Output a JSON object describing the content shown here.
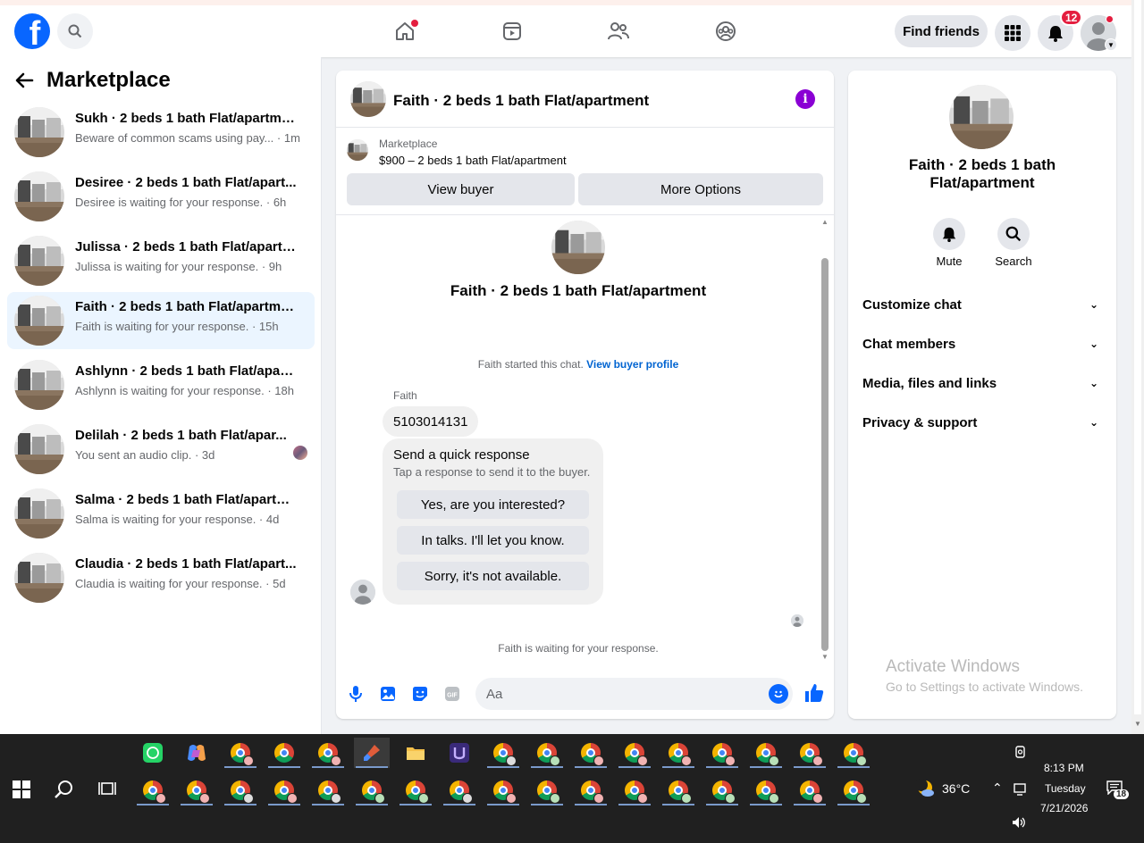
{
  "topbar": {
    "logo_letter": "f",
    "find_friends_label": "Find friends",
    "notifications_count": "12"
  },
  "sidebar": {
    "title": "Marketplace",
    "conversations": [
      {
        "title": "Sukh · 2 beds 1 bath Flat/apartment",
        "subtitle": "Beware of common scams using pay... · 1m"
      },
      {
        "title": "Desiree · 2 beds 1 bath Flat/apart...",
        "subtitle": "Desiree is waiting for your response. · 6h"
      },
      {
        "title": "Julissa · 2 beds 1 bath Flat/apartm...",
        "subtitle": "Julissa is waiting for your response. · 9h"
      },
      {
        "title": "Faith · 2 beds 1 bath Flat/apartment",
        "subtitle": "Faith is waiting for your response. · 15h"
      },
      {
        "title": "Ashlynn · 2 beds 1 bath Flat/apart...",
        "subtitle": "Ashlynn is waiting for your response. · 18h"
      },
      {
        "title": "Delilah · 2 beds 1 bath Flat/apar...",
        "subtitle": "You sent an audio clip. · 3d"
      },
      {
        "title": "Salma · 2 beds 1 bath Flat/apartme...",
        "subtitle": "Salma is waiting for your response. · 4d"
      },
      {
        "title": "Claudia · 2 beds 1 bath Flat/apart...",
        "subtitle": "Claudia is waiting for your response. · 5d"
      }
    ]
  },
  "chat": {
    "header_title": "Faith · 2 beds 1 bath Flat/apartment",
    "marketplace_label": "Marketplace",
    "listing_price": "$900 – 2 beds 1 bath Flat/apartment",
    "view_buyer_label": "View buyer",
    "more_options_label": "More Options",
    "intro_title": "Faith · 2 beds 1 bath Flat/apartment",
    "started_text": "Faith started this chat.",
    "view_profile_link": "View buyer profile",
    "sender_name": "Faith",
    "message_text": "5103014131",
    "quick_title": "Send a quick response",
    "quick_subtitle": "Tap a response to send it to the buyer.",
    "quick_responses": [
      "Yes, are you interested?",
      "In talks. I'll let you know.",
      "Sorry, it's not available."
    ],
    "waiting_text": "Faith is waiting for your response.",
    "composer_placeholder": "Aa"
  },
  "details": {
    "title": "Faith · 2 beds 1 bath Flat/apartment",
    "mute_label": "Mute",
    "search_label": "Search",
    "rows": [
      "Customize chat",
      "Chat members",
      "Media, files and links",
      "Privacy & support"
    ],
    "activate_title": "Activate Windows",
    "activate_sub": "Go to Settings to activate Windows."
  },
  "taskbar": {
    "temperature": "36°C",
    "time": "8:13 PM",
    "day": "Tuesday",
    "date": "7/21/2026",
    "notification_count": "18"
  },
  "colors": {
    "brand": "#0866ff",
    "active_row": "#ebf5ff",
    "info_purple": "#8a00d4",
    "badge_red": "#e41e3f"
  }
}
